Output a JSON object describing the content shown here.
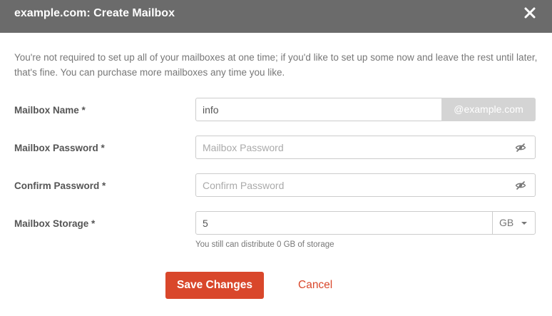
{
  "dialog": {
    "title": "example.com: Create Mailbox",
    "close_icon": "close-icon"
  },
  "intro": "You're not required to set up all of your mailboxes at one time; if you'd like to set up some now and leave the rest until later, that's fine. You can purchase more mailboxes any time you like.",
  "form": {
    "mailbox_name": {
      "label": "Mailbox Name *",
      "value": "info",
      "domain_suffix": "@example.com"
    },
    "mailbox_password": {
      "label": "Mailbox Password *",
      "placeholder": "Mailbox Password",
      "toggle_icon": "eye-slash-icon"
    },
    "confirm_password": {
      "label": "Confirm Password *",
      "placeholder": "Confirm Password",
      "toggle_icon": "eye-slash-icon"
    },
    "mailbox_storage": {
      "label": "Mailbox Storage *",
      "value": "5",
      "unit": "GB",
      "helper": "You still can distribute 0 GB of storage"
    }
  },
  "actions": {
    "save_label": "Save Changes",
    "cancel_label": "Cancel"
  },
  "colors": {
    "header_bg": "#6b6b6b",
    "accent": "#d9472b",
    "addon_bg": "#d4d4d4"
  }
}
